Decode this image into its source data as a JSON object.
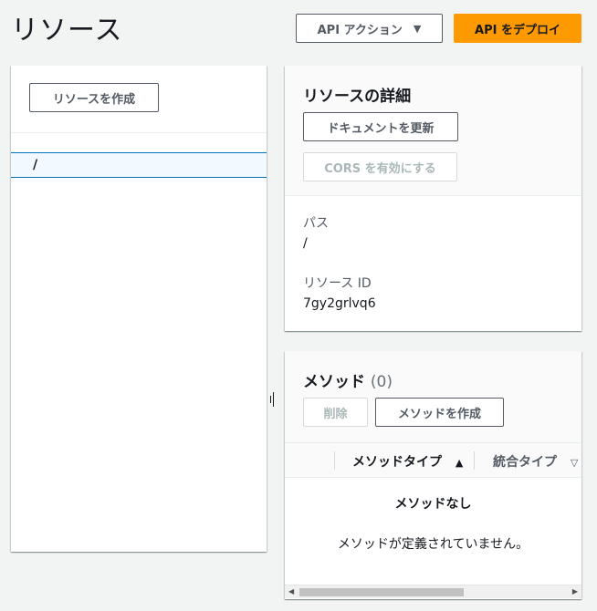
{
  "page": {
    "title": "リソース"
  },
  "toolbar": {
    "api_actions_label": "API アクション",
    "deploy_label": "API をデプロイ"
  },
  "resources": {
    "create_label": "リソースを作成",
    "tree": [
      {
        "path": "/"
      }
    ]
  },
  "details": {
    "title": "リソースの詳細",
    "update_docs_label": "ドキュメントを更新",
    "enable_cors_label": "CORS を有効にする",
    "path_label": "パス",
    "path_value": "/",
    "id_label": "リソース ID",
    "id_value": "7gy2grlvq6"
  },
  "methods": {
    "title": "メソッド",
    "count": "(0)",
    "delete_label": "削除",
    "create_label": "メソッドを作成",
    "columns": [
      {
        "label": "メソッドタイプ",
        "sort": "▲"
      },
      {
        "label": "統合タイプ",
        "sort": "▽"
      }
    ],
    "empty_title": "メソッドなし",
    "empty_text": "メソッドが定義されていません。"
  },
  "colors": {
    "accent": "#ff9900",
    "selection_border": "#0073bb",
    "selection_bg": "#f1faff"
  }
}
